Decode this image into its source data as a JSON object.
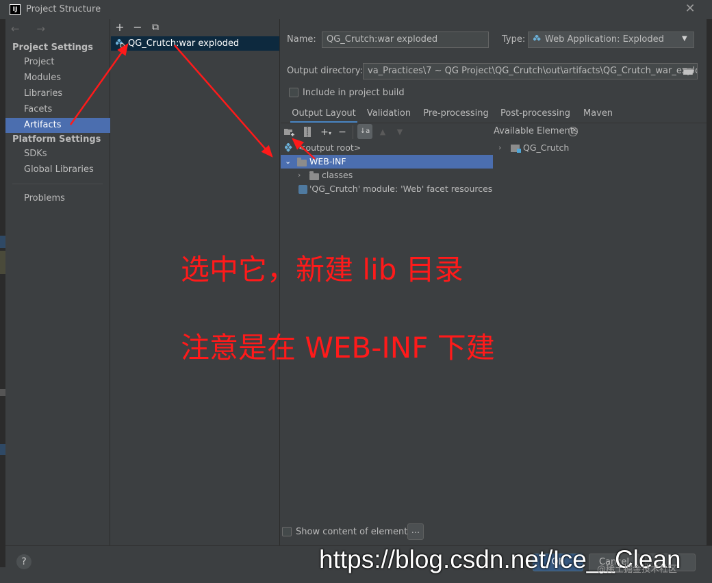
{
  "window": {
    "title": "Project Structure",
    "app_icon": "IJ"
  },
  "sidebar": {
    "nav_arrows": "← →",
    "project_settings_header": "Project Settings",
    "items_project": [
      "Project",
      "Modules",
      "Libraries",
      "Facets",
      "Artifacts"
    ],
    "platform_settings_header": "Platform Settings",
    "items_platform": [
      "SDKs",
      "Global Libraries"
    ],
    "problems": "Problems",
    "selected": "Artifacts"
  },
  "artifacts": {
    "toolbar": {
      "add": "+",
      "remove": "−",
      "copy": "⧉"
    },
    "items": [
      "QG_Crutch:war exploded"
    ]
  },
  "details": {
    "name_label": "Name:",
    "name_value": "QG_Crutch:war exploded",
    "type_label": "Type:",
    "type_value": "Web Application: Exploded",
    "output_dir_label": "Output directory:",
    "output_dir_value": "va_Practices\\7 ~ QG Project\\QG_Crutch\\out\\artifacts\\QG_Crutch_war_exploded",
    "include_label": "Include in project build",
    "include_checked": false
  },
  "tabs": [
    "Output Layout",
    "Validation",
    "Pre-processing",
    "Post-processing",
    "Maven"
  ],
  "selected_tab": "Output Layout",
  "layout_tree": {
    "root": "<output root>",
    "web_inf": "WEB-INF",
    "classes": "classes",
    "facet_resources": "'QG_Crutch' module: 'Web' facet resources"
  },
  "available": {
    "title": "Available Elements",
    "help": "?",
    "items": [
      "QG_Crutch"
    ]
  },
  "show_content_label": "Show content of elements",
  "show_content_btn": "...",
  "annotations": {
    "line1": "选中它，新建 lib 目录",
    "line2": "注意是在 WEB-INF 下建",
    "color": "#ff1a1a"
  },
  "footer": {
    "help": "?",
    "ok": "OK",
    "cancel": "Cancel",
    "watermark": "https://blog.csdn.net/Ice__Clean",
    "watermark2": "@稀土掘金技术社区"
  },
  "colors": {
    "selection": "#4b6eaf",
    "background": "#3c3f41",
    "accent": "#4a88c7"
  }
}
